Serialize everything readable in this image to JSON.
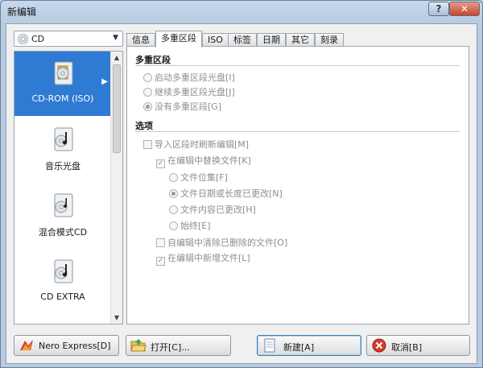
{
  "window": {
    "title": "新编辑",
    "help_label": "?",
    "close_label": "✕"
  },
  "disc_type": {
    "value": "CD",
    "arrow": "▼"
  },
  "categories": [
    {
      "label": "CD-ROM (ISO)",
      "icon": "cd-rom-icon",
      "selected": true
    },
    {
      "label": "音乐光盘",
      "icon": "music-disc-icon"
    },
    {
      "label": "混合模式CD",
      "icon": "mixed-mode-icon"
    },
    {
      "label": "CD EXTRA",
      "icon": "cd-extra-icon"
    }
  ],
  "tabs": [
    "信息",
    "多重区段",
    "ISO",
    "标签",
    "日期",
    "其它",
    "刻录"
  ],
  "active_tab": "多重区段",
  "multisession": {
    "title": "多重区段",
    "options": [
      {
        "label": "启动多重区段光盘[I]",
        "checked": false
      },
      {
        "label": "继续多重区段光盘[J]",
        "checked": false
      },
      {
        "label": "没有多重区段[G]",
        "checked": true
      }
    ]
  },
  "options": {
    "title": "选项",
    "import_refresh": "导入区段时刷新编辑[M]",
    "replace_in_compilation": "在编辑中替换文件[K]",
    "replace_modes": [
      {
        "label": "文件位集[F]",
        "checked": false
      },
      {
        "label": "文件日期或长度已更改[N]",
        "checked": true
      },
      {
        "label": "文件内容已更改[H]",
        "checked": false
      },
      {
        "label": "始终[E]",
        "checked": false
      }
    ],
    "remove_deleted": "自编辑中清除已删除的文件[O]",
    "add_new": "在编辑中新增文件[L]"
  },
  "buttons": {
    "nero_express": "Nero Express[D]",
    "open": "打开[C]...",
    "new": "新建[A]",
    "cancel": "取消[B]"
  },
  "scroll": {
    "up": "▲",
    "down": "▼"
  },
  "colors": {
    "selection": "#2f7bd3",
    "title_bar": "#c8d9ec",
    "close": "#c7452a"
  }
}
